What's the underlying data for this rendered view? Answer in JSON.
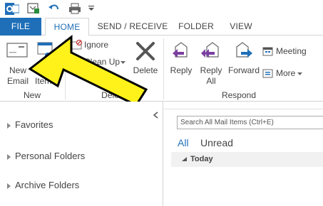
{
  "tabs": [
    "FILE",
    "HOME",
    "SEND / RECEIVE",
    "FOLDER",
    "VIEW"
  ],
  "ribbon": {
    "new_group": {
      "label": "New",
      "new_email_line1": "New",
      "new_email_line2": "Email",
      "new_items_partial": "Item"
    },
    "delete_group": {
      "label": "Delete",
      "ignore": "Ignore",
      "clean_up": "Clean Up",
      "delete": "Delete"
    },
    "respond_group": {
      "label": "Respond",
      "reply": "Reply",
      "reply_all_line1": "Reply",
      "reply_all_line2": "All",
      "forward": "Forward",
      "meeting": "Meeting",
      "more": "More"
    }
  },
  "folder_pane": {
    "items": [
      "Favorites",
      "Personal Folders",
      "Archive Folders"
    ]
  },
  "mail_list": {
    "search_placeholder": "Search All Mail Items (Ctrl+E)",
    "filter_all": "All",
    "filter_unread": "Unread",
    "group_today": "Today"
  },
  "colors": {
    "accent": "#1f6fb8",
    "arrow": "#fff21a"
  },
  "icons": [
    "outlook-icon",
    "send-receive-icon",
    "undo-icon",
    "print-icon",
    "customize-qat-icon",
    "new-email-icon",
    "new-items-icon",
    "ignore-icon",
    "clean-up-icon",
    "delete-x-icon",
    "reply-icon",
    "reply-all-icon",
    "forward-icon",
    "meeting-icon",
    "more-icon"
  ]
}
